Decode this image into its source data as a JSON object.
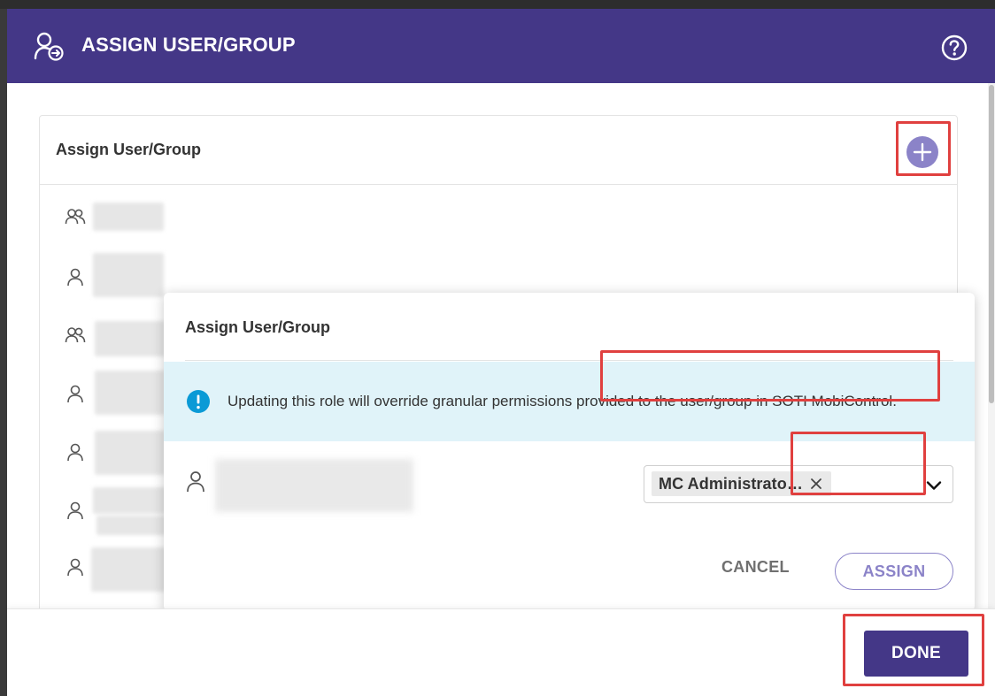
{
  "header": {
    "title": "ASSIGN USER/GROUP",
    "icon": "user-assign-icon",
    "help_icon": "help-icon"
  },
  "card": {
    "title": "Assign User/Group",
    "add_icon": "plus-icon",
    "rows": [
      {
        "type": "group",
        "icon": "group-icon"
      },
      {
        "type": "user",
        "icon": "user-icon"
      },
      {
        "type": "group",
        "icon": "group-icon"
      },
      {
        "type": "user",
        "icon": "user-icon"
      },
      {
        "type": "user",
        "icon": "user-icon"
      },
      {
        "type": "user",
        "icon": "user-icon"
      },
      {
        "type": "user",
        "icon": "user-icon"
      }
    ]
  },
  "popover": {
    "title": "Assign User/Group",
    "info_message": "Updating this role will override granular permissions provided to the user/group in SOTI MobiControl.",
    "role_select": {
      "selected": "MC Administrato…"
    },
    "cancel_label": "CANCEL",
    "assign_label": "ASSIGN"
  },
  "footer": {
    "done_label": "DONE"
  },
  "colors": {
    "header_bg": "#443787",
    "accent": "#8b83c8",
    "info_bg": "#e0f3f9",
    "info_icon": "#0a9ad6",
    "highlight": "#e0403f"
  }
}
